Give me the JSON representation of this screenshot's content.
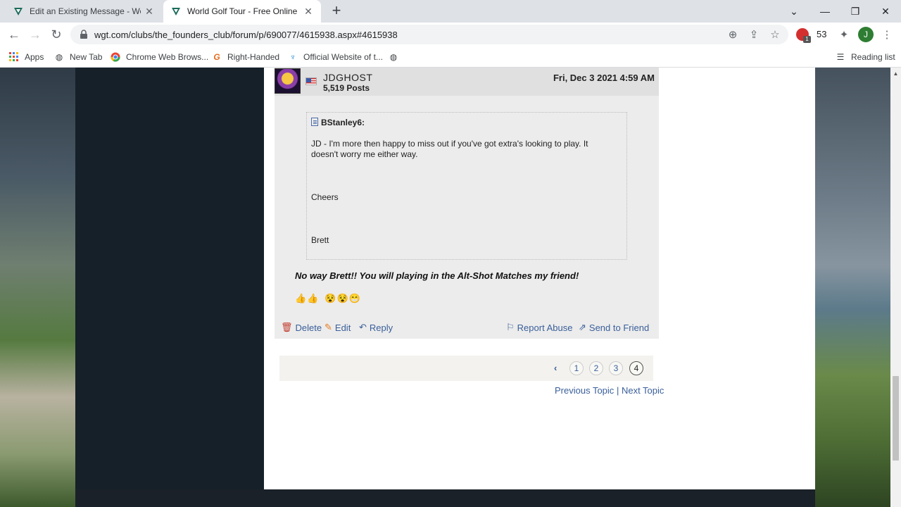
{
  "browser": {
    "tabs": [
      {
        "title": "Edit an Existing Message - World",
        "active": false
      },
      {
        "title": "World Golf Tour - Free Online Go",
        "active": true
      }
    ],
    "url": "wgt.com/clubs/the_founders_club/forum/p/690077/4615938.aspx#4615938",
    "extension_badge": "1",
    "extension_count": "53",
    "profile_initial": "J",
    "bookmarks": [
      {
        "label": "Apps",
        "icon": "apps-grid-icon"
      },
      {
        "label": "New Tab",
        "icon": "globe-icon"
      },
      {
        "label": "Chrome Web Brows...",
        "icon": "chrome-icon"
      },
      {
        "label": "Right-Handed",
        "icon": "g-logo-icon"
      },
      {
        "label": "Official Website of t...",
        "icon": "shield-icon"
      },
      {
        "label": "",
        "icon": "globe-icon"
      }
    ],
    "reading_list": "Reading list"
  },
  "post": {
    "author": "JDGHOST",
    "post_count": "5,519 Posts",
    "date": "Fri, Dec 3 2021 4:59 AM",
    "quote": {
      "author": "BStanley6:",
      "text": "JD - I'm more then happy to miss out if you've got extra's looking to play. It doesn't worry me either way.",
      "cheers": "Cheers",
      "signature": "Brett"
    },
    "reply_text": "No way Brett!!  You will playing in the Alt-Shot Matches my friend!",
    "emojis_group1": "👍👍",
    "emojis_group2": "😵😵😁",
    "actions": {
      "delete": "Delete",
      "edit": "Edit",
      "reply": "Reply",
      "report": "Report Abuse",
      "send": "Send to Friend"
    }
  },
  "pager": {
    "prev": "‹",
    "pages": [
      "1",
      "2",
      "3",
      "4"
    ],
    "current": "4"
  },
  "topic_nav": {
    "previous": "Previous Topic",
    "separator": "|",
    "next": "Next Topic"
  },
  "colors": {
    "link": "#3a5f9a",
    "delete_icon": "#c0392b",
    "edit_icon": "#e67e22",
    "sidebar": "#152029"
  }
}
